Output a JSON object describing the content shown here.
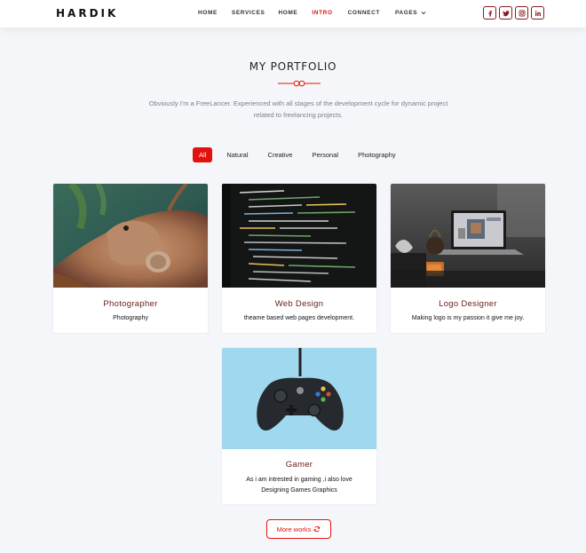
{
  "brand": {
    "logo": "HARDIK"
  },
  "nav": {
    "items": [
      {
        "label": "HOME"
      },
      {
        "label": "SERVICES"
      },
      {
        "label": "HOME"
      },
      {
        "label": "INTRO"
      },
      {
        "label": "CONNECT"
      },
      {
        "label": "PAGES"
      }
    ],
    "active": "INTRO"
  },
  "social": {
    "items": [
      "facebook-icon",
      "twitter-icon",
      "instagram-icon",
      "linkedin-icon"
    ],
    "border_color": "#8a1a1a"
  },
  "header": {
    "title": "MY PORTFOLIO",
    "subtitle": "Obviously I'm a FreeLancer. Experienced with all stages of the development cycle for dynamic project related to freelancing projects."
  },
  "filters": {
    "items": [
      "All",
      "Natural",
      "Creative",
      "Personal",
      "Photography"
    ],
    "active": "All"
  },
  "cards": [
    {
      "title": "Photographer",
      "desc": "Photography",
      "image": "iguana-photo"
    },
    {
      "title": "Web Design",
      "desc": "theame based web pages development.",
      "image": "code-screen-photo"
    },
    {
      "title": "Logo Designer",
      "desc": "Making logo is my passion it give me joy.",
      "image": "laptop-desk-photo"
    },
    {
      "title": "Gamer",
      "desc": "As i am intrested in gaming ,i also love Designing Games Graphics",
      "image": "gamepad-photo"
    }
  ],
  "more_button": {
    "label": "More works"
  },
  "colors": {
    "accent": "#e3110d",
    "card_title": "#6b1a1a",
    "background": "#f5f6fa",
    "subtitle": "#7a7f8c"
  }
}
